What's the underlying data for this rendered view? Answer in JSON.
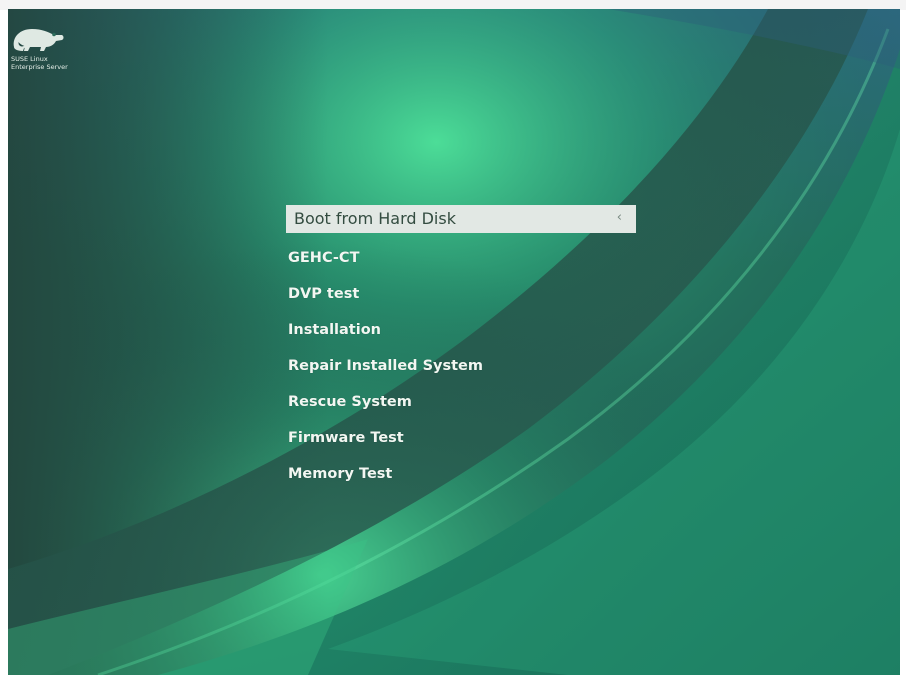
{
  "logo": {
    "icon": "chameleon-icon",
    "line1": "SUSE Linux",
    "line2": "Enterprise Server"
  },
  "boot_menu": {
    "selected_index": 0,
    "items": [
      {
        "label": "Boot from Hard Disk"
      },
      {
        "label": "GEHC-CT"
      },
      {
        "label": "DVP test"
      },
      {
        "label": "Installation"
      },
      {
        "label": "Repair Installed System"
      },
      {
        "label": "Rescue System"
      },
      {
        "label": "Firmware Test"
      },
      {
        "label": "Memory Test"
      }
    ]
  },
  "colors": {
    "background_dark": "#1f6b58",
    "background_light": "#3fcf8a",
    "selection_bar": "#e2e8e4",
    "menu_text": "#f2f7f2"
  }
}
